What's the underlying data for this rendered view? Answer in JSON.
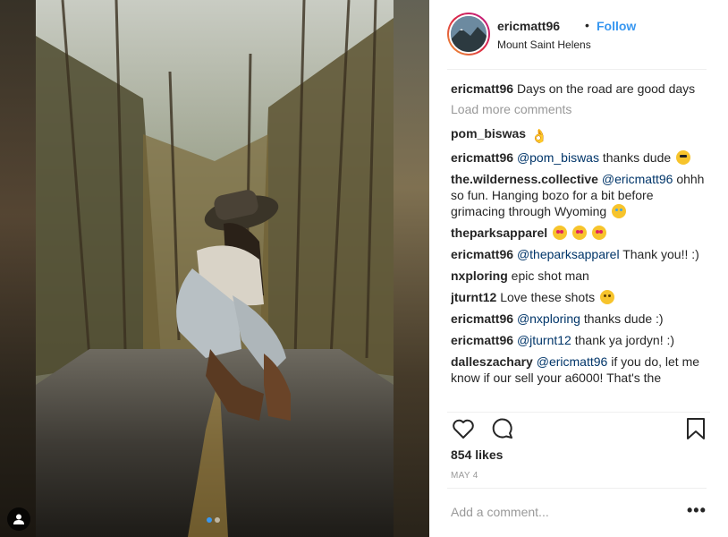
{
  "post": {
    "username": "ericmatt96",
    "separator": "•",
    "follow_label": "Follow",
    "location": "Mount Saint Helens",
    "likes": "854 likes",
    "date": "MAY 4",
    "add_comment_placeholder": "Add a comment...",
    "more_options": "•••",
    "carousel": {
      "total": 2,
      "active": 1
    }
  },
  "caption": {
    "user": "ericmatt96",
    "text": "Days on the road are good days"
  },
  "load_more": "Load more comments",
  "comments": [
    {
      "user": "pom_biswas",
      "text": "",
      "emoji": "ok-hand"
    },
    {
      "user": "ericmatt96",
      "mention": "@pom_biswas",
      "text": " thanks dude",
      "emoji": "sunglasses"
    },
    {
      "user": "the.wilderness.collective",
      "mention": "@ericmatt96",
      "text": " ohhh so fun. Hanging bozo for a bit before grimacing through Wyoming",
      "emoji": "loudly-crying"
    },
    {
      "user": "theparksapparel",
      "text": "",
      "emoji": "heart-eyes x3"
    },
    {
      "user": "ericmatt96",
      "mention": "@theparksapparel",
      "text": " Thank you!! :)"
    },
    {
      "user": "nxploring",
      "text": " epic shot man"
    },
    {
      "user": "jturnt12",
      "text": " Love these shots",
      "emoji": "relieved"
    },
    {
      "user": "ericmatt96",
      "mention": "@nxploring",
      "text": " thanks dude :)"
    },
    {
      "user": "ericmatt96",
      "mention": "@jturnt12",
      "text": " thank ya jordyn! :)"
    },
    {
      "user": "dalleszachary",
      "mention": "@ericmatt96",
      "text": " if you do, let me know if our sell your a6000! That's the"
    }
  ],
  "icons": {
    "like": "heart-outline-icon",
    "comment": "comment-bubble-icon",
    "save": "bookmark-icon",
    "tag": "user-tag-icon"
  },
  "colors": {
    "link": "#3897f0",
    "mention": "#003569",
    "muted": "#999999",
    "text": "#262626"
  }
}
